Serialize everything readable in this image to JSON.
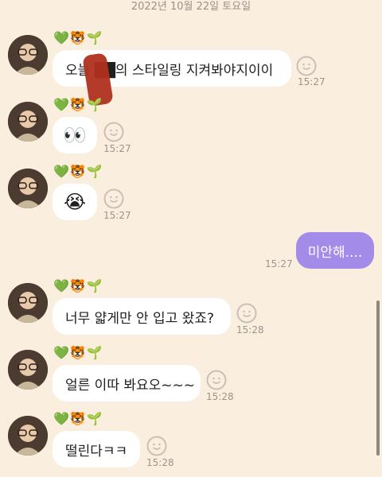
{
  "header": {
    "date": "2022년 10월 22일 토요일"
  },
  "sender": {
    "name": "💚🐯🌱"
  },
  "messages": [
    {
      "text": "오늘 ██의 스타일링 지켜봐야지이이",
      "time": "15:27"
    },
    {
      "text": "👀",
      "time": "15:27"
    },
    {
      "text": "😭",
      "time": "15:27"
    },
    {
      "text": "미안해....",
      "time": "15:27",
      "mine": true
    },
    {
      "text": "너무 얇게만 안 입고 왔죠?",
      "time": "15:28"
    },
    {
      "text": "얼른 이따 봐요오~~~",
      "time": "15:28"
    },
    {
      "text": "떨린다ㅋㅋ",
      "time": "15:28"
    }
  ],
  "icons": {
    "reaction": "smiley-add-icon",
    "avatar": "profile-photo"
  },
  "colors": {
    "background": "#FAEEDF",
    "my_bubble": "#A28BE9",
    "their_bubble": "#FFFFFF",
    "time": "#9C938C"
  }
}
